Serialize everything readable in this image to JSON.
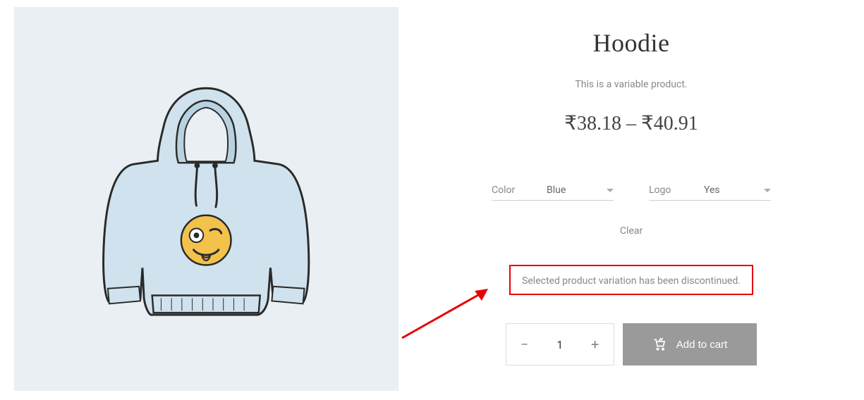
{
  "product": {
    "title": "Hoodie",
    "description": "This is a variable product.",
    "price_display": "₹38.18 – ₹40.91"
  },
  "variations": {
    "color": {
      "label": "Color",
      "selected": "Blue"
    },
    "logo": {
      "label": "Logo",
      "selected": "Yes"
    }
  },
  "clear_label": "Clear",
  "notice_text": "Selected product variation has been discontinued.",
  "quantity": {
    "value": "1",
    "minus": "−",
    "plus": "+"
  },
  "add_to_cart_label": "Add to cart"
}
